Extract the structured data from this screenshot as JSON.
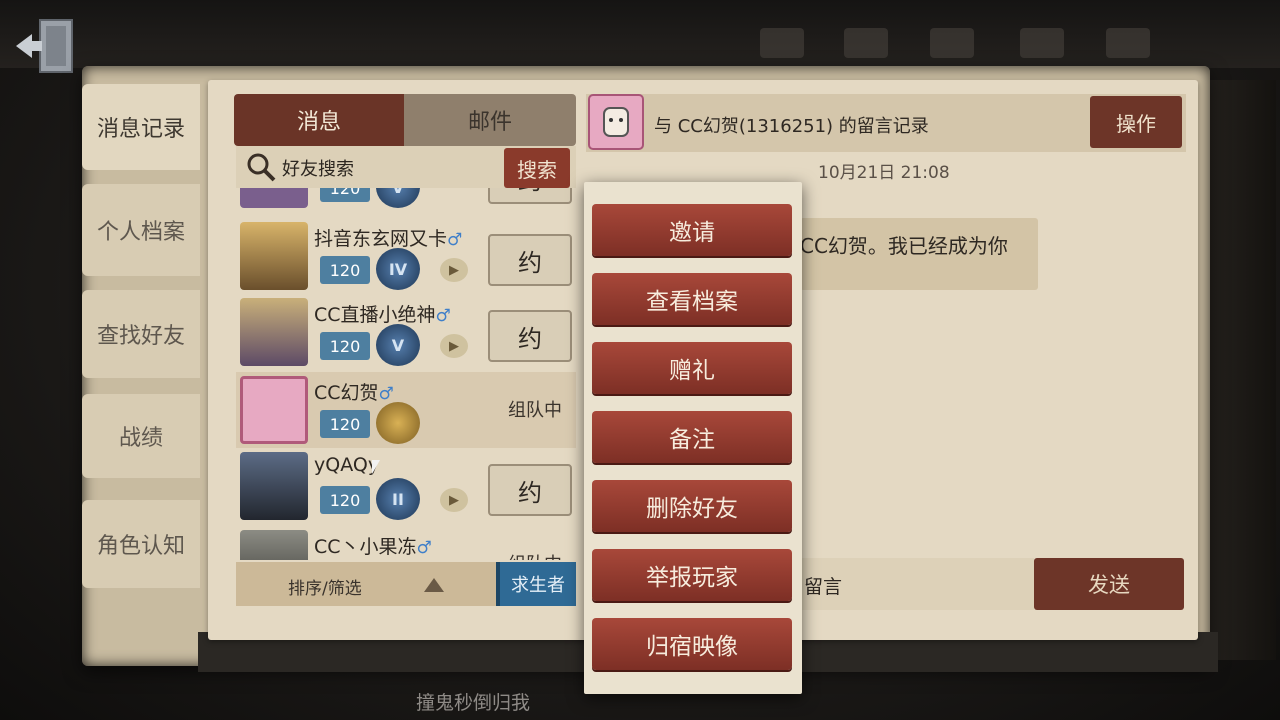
{
  "tabs": [
    {
      "label": "消息记录",
      "active": true
    },
    {
      "label": "个人档案",
      "active": false
    },
    {
      "label": "查找好友",
      "active": false
    },
    {
      "label": "战绩",
      "active": false
    },
    {
      "label": "角色认知",
      "active": false
    }
  ],
  "segments": {
    "message": "消息",
    "mail": "邮件"
  },
  "search": {
    "placeholder": "好友搜索",
    "button": "搜索"
  },
  "friends": [
    {
      "name": "",
      "level": "120",
      "rank": "V",
      "gender": "",
      "action": "约",
      "status": "",
      "play_icon": false
    },
    {
      "name": "抖音东玄网又卡",
      "gender": "♂",
      "level": "120",
      "rank": "IV",
      "action": "约",
      "status": "",
      "play_icon": true
    },
    {
      "name": "CC直播小绝神",
      "gender": "♂",
      "level": "120",
      "rank": "V",
      "action": "约",
      "status": "",
      "play_icon": true
    },
    {
      "name": "CC幻贺",
      "gender": "♂",
      "level": "120",
      "rank": "",
      "action": "",
      "status": "组队中",
      "play_icon": false
    },
    {
      "name": "yQAQy",
      "gender": "",
      "level": "120",
      "rank": "II",
      "action": "约",
      "status": "",
      "play_icon": true
    },
    {
      "name": "CC丶小果冻",
      "gender": "♂",
      "level": "",
      "rank": "",
      "action": "",
      "status": "组队中",
      "play_icon": false
    }
  ],
  "sort": {
    "label": "排序/筛选",
    "role": "求生者"
  },
  "chat": {
    "header": "与 CC幻贺(1316251) 的留言记录",
    "operate": "操作",
    "timestamp": "10月21日 21:08",
    "message": "CC幻贺。我已经成为你",
    "input_placeholder": "留言",
    "send": "发送"
  },
  "menu": [
    "邀请",
    "查看档案",
    "赠礼",
    "备注",
    "删除好友",
    "举报玩家",
    "归宿映像"
  ],
  "bottom_text": "撞鬼秒倒归我",
  "colors": {
    "accent_red": "#7d2f25",
    "paper": "#e4d9c3",
    "role_blue": "#2f6a95"
  }
}
